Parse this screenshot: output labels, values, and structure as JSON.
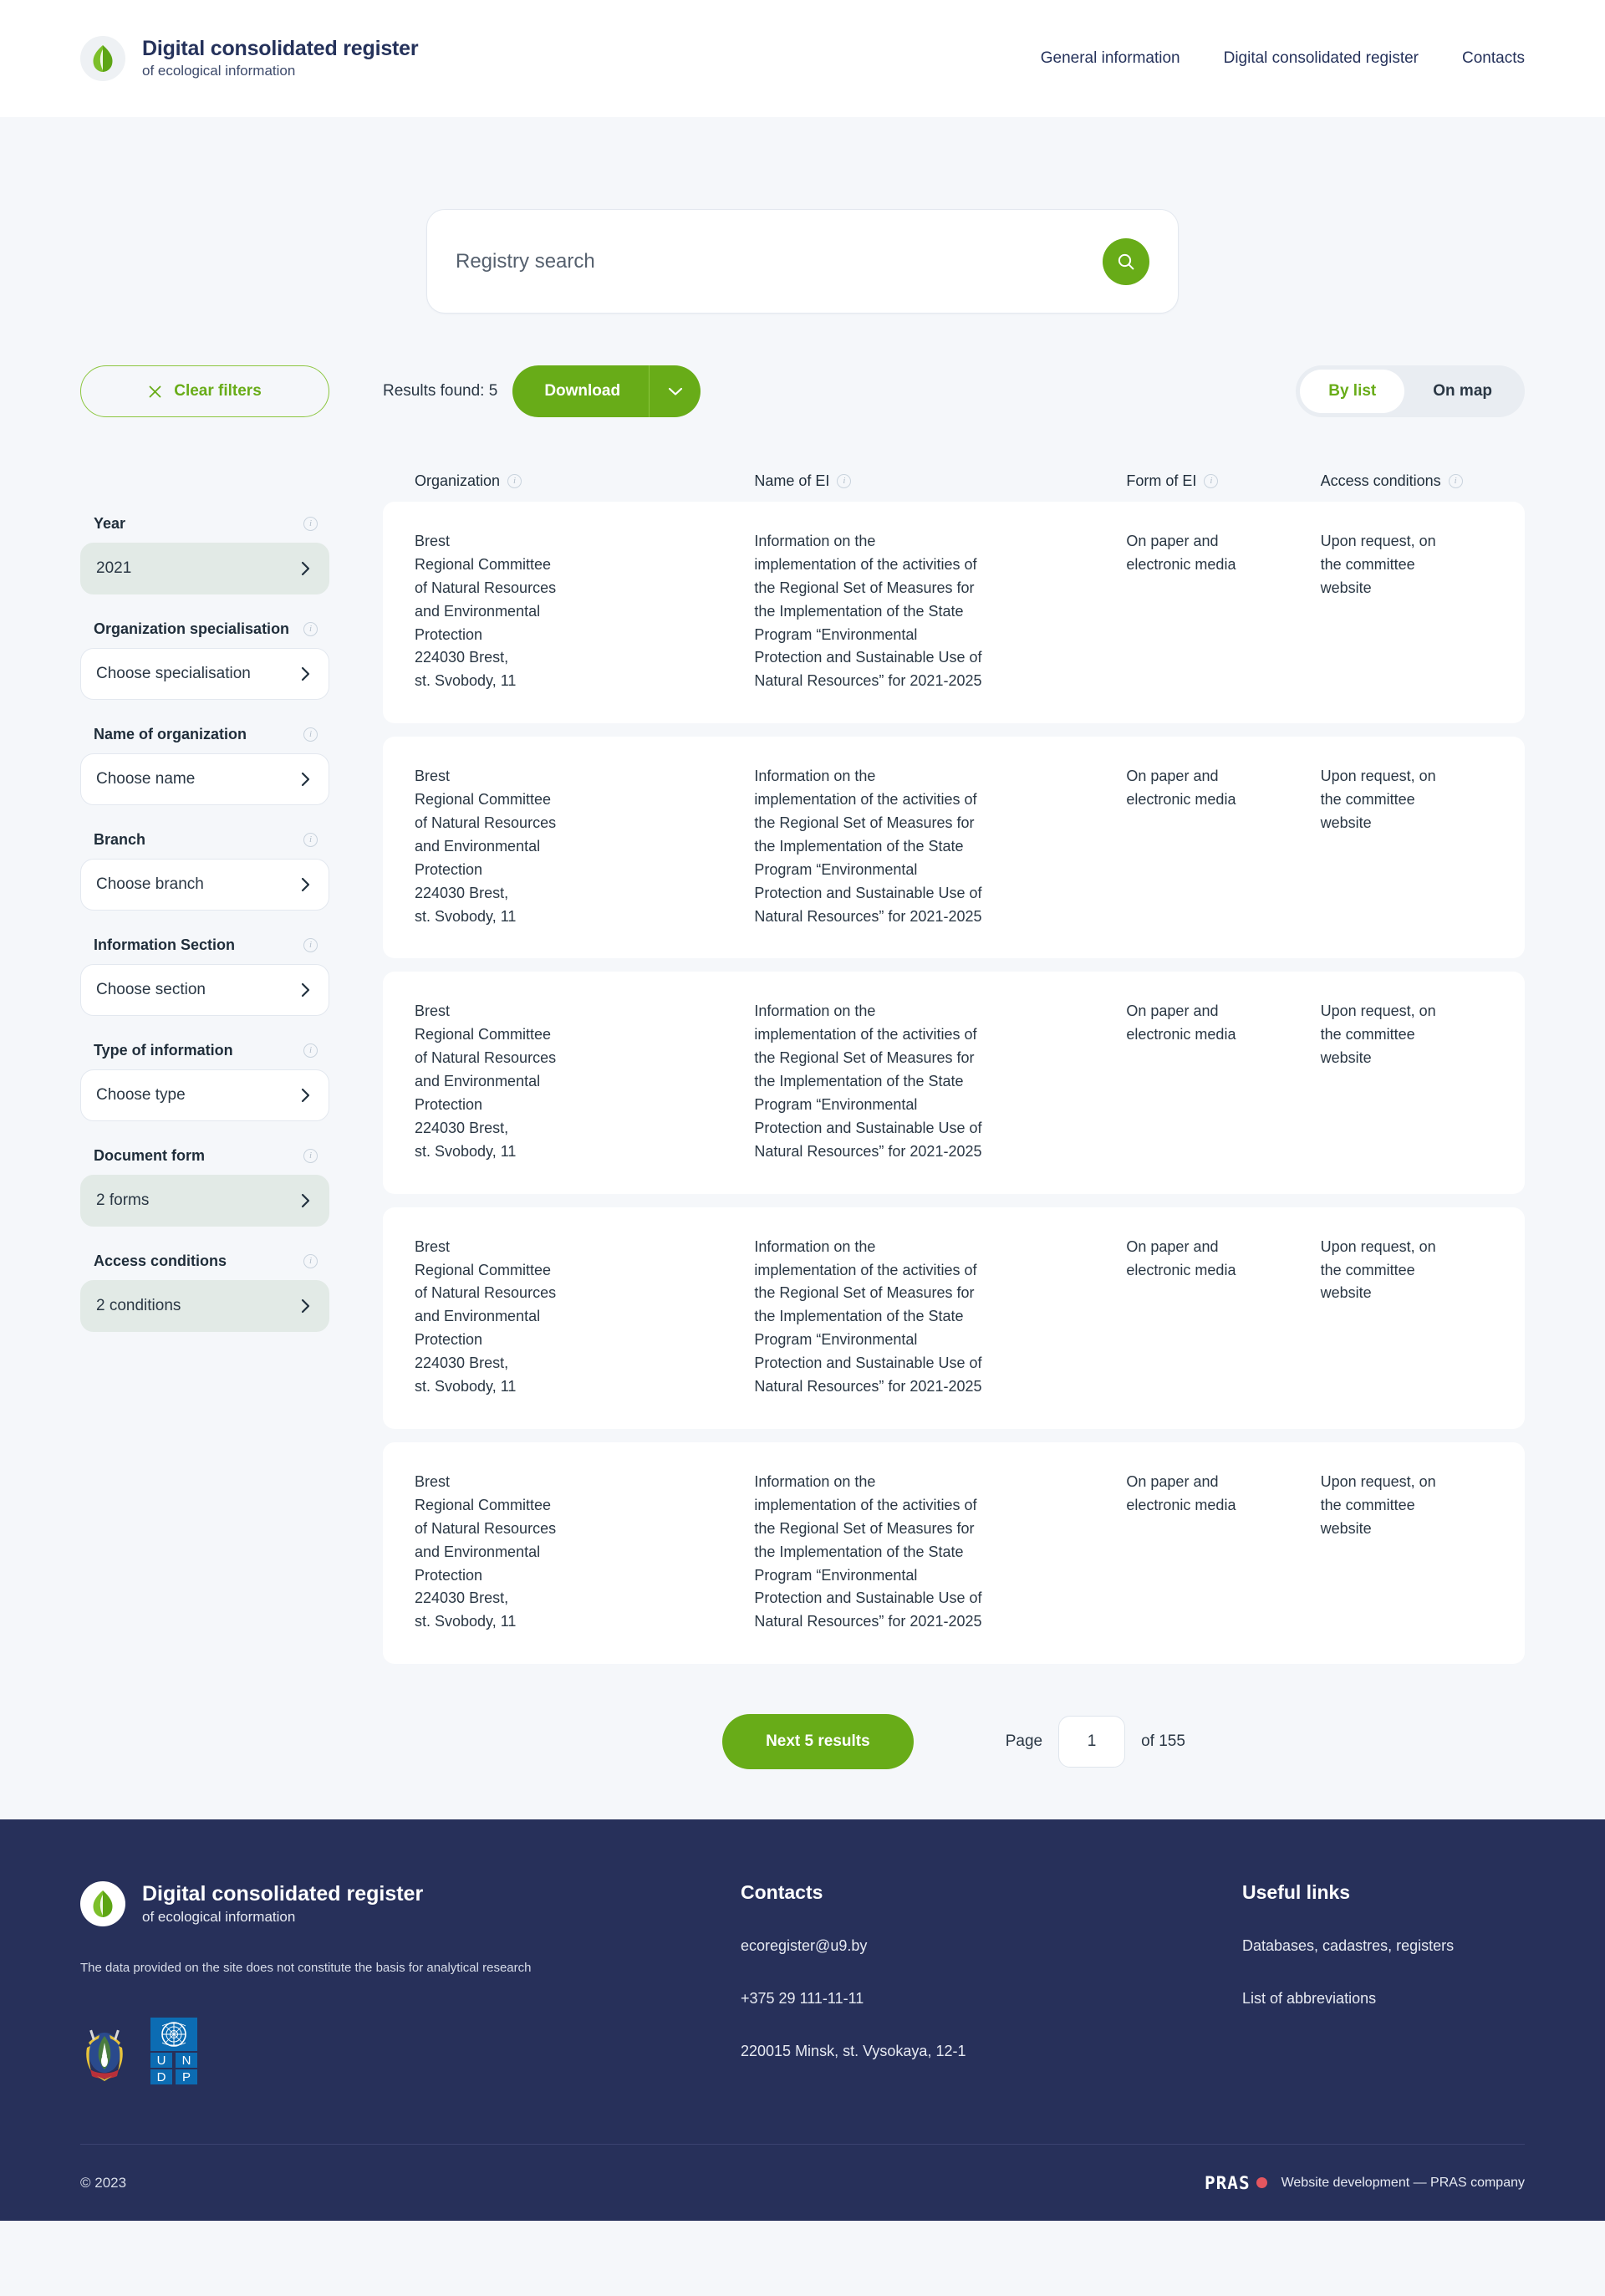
{
  "brand": {
    "title": "Digital consolidated register",
    "subtitle": "of ecological information"
  },
  "nav": {
    "items": [
      {
        "label": "General information"
      },
      {
        "label": "Digital consolidated register"
      },
      {
        "label": "Contacts"
      }
    ]
  },
  "search": {
    "placeholder": "Registry search",
    "value": "",
    "icon": "search-icon"
  },
  "sidebar": {
    "clear_filters_label": "Clear filters",
    "clear_icon": "close-x-icon",
    "filters": [
      {
        "label": "Year",
        "value": "2021",
        "selected": true
      },
      {
        "label": "Organization specialisation",
        "value": "Choose specialisation",
        "selected": false
      },
      {
        "label": "Name of organization",
        "value": "Choose name",
        "selected": false
      },
      {
        "label": "Branch",
        "value": "Choose branch",
        "selected": false
      },
      {
        "label": "Information Section",
        "value": "Choose section",
        "selected": false
      },
      {
        "label": "Type of information",
        "value": "Choose type",
        "selected": false
      },
      {
        "label": "Document form",
        "value": "2 forms",
        "selected": true
      },
      {
        "label": "Access conditions",
        "value": "2 conditions",
        "selected": true
      }
    ]
  },
  "toolbar": {
    "results_found": "Results found: 5",
    "download_label": "Download",
    "download_caret_icon": "chevron-down-icon",
    "view_by_list": "By list",
    "view_on_map": "On map",
    "active_view": "By list"
  },
  "table": {
    "columns": [
      {
        "label": "Organization"
      },
      {
        "label": "Name of EI"
      },
      {
        "label": "Form of EI"
      },
      {
        "label": "Access conditions"
      }
    ],
    "rows": [
      {
        "organization": "Brest\nRegional Committee\nof Natural Resources\nand Environmental\nProtection\n224030 Brest,\nst. Svobody, 11",
        "name_of_ei": "Information on the\nimplementation of the activities of\nthe Regional Set of Measures for\nthe Implementation of the State\nProgram “Environmental\nProtection and Sustainable Use of\nNatural Resources” for 2021-2025",
        "form_of_ei": "On paper and\nelectronic media",
        "access_conditions": "Upon request, on\nthe committee\nwebsite"
      },
      {
        "organization": "Brest\nRegional Committee\nof Natural Resources\nand Environmental\nProtection\n224030 Brest,\nst. Svobody, 11",
        "name_of_ei": "Information on the\nimplementation of the activities of\nthe Regional Set of Measures for\nthe Implementation of the State\nProgram “Environmental\nProtection and Sustainable Use of\nNatural Resources” for 2021-2025",
        "form_of_ei": "On paper and\nelectronic media",
        "access_conditions": "Upon request, on\nthe committee\nwebsite"
      },
      {
        "organization": "Brest\nRegional Committee\nof Natural Resources\nand Environmental\nProtection\n224030 Brest,\nst. Svobody, 11",
        "name_of_ei": "Information on the\nimplementation of the activities of\nthe Regional Set of Measures for\nthe Implementation of the State\nProgram “Environmental\nProtection and Sustainable Use of\nNatural Resources” for 2021-2025",
        "form_of_ei": "On paper and\nelectronic media",
        "access_conditions": "Upon request, on\nthe committee\nwebsite"
      },
      {
        "organization": "Brest\nRegional Committee\nof Natural Resources\nand Environmental\nProtection\n224030 Brest,\nst. Svobody, 11",
        "name_of_ei": "Information on the\nimplementation of the activities of\nthe Regional Set of Measures for\nthe Implementation of the State\nProgram “Environmental\nProtection and Sustainable Use of\nNatural Resources” for 2021-2025",
        "form_of_ei": "On paper and\nelectronic media",
        "access_conditions": "Upon request, on\nthe committee\nwebsite"
      },
      {
        "organization": "Brest\nRegional Committee\nof Natural Resources\nand Environmental\nProtection\n224030 Brest,\nst. Svobody, 11",
        "name_of_ei": "Information on the\nimplementation of the activities of\nthe Regional Set of Measures for\nthe Implementation of the State\nProgram “Environmental\nProtection and Sustainable Use of\nNatural Resources” for 2021-2025",
        "form_of_ei": "On paper and\nelectronic media",
        "access_conditions": "Upon request, on\nthe committee\nwebsite"
      }
    ]
  },
  "pagination": {
    "next_label": "Next 5 results",
    "page_label": "Page",
    "page_value": "1",
    "total_label": "of 155"
  },
  "footer": {
    "brand_title": "Digital consolidated register",
    "brand_subtitle": "of ecological information",
    "disclaimer": "The data provided on the site does not constitute the basis for analytical research",
    "badges": [
      {
        "name": "coat-of-arms-belarus"
      },
      {
        "name": "undp-logo",
        "letters": [
          "U",
          "N",
          "D",
          "P"
        ]
      }
    ],
    "contacts": {
      "title": "Contacts",
      "email": "ecoregister@u9.by",
      "phone": "+375 29 111-11-11",
      "address": "220015 Minsk, st. Vysokaya, 12-1"
    },
    "useful_links": {
      "title": "Useful links",
      "items": [
        {
          "label": "Databases, cadastres, registers"
        },
        {
          "label": "List of abbreviations"
        }
      ]
    },
    "copyright": "© 2023",
    "developer": {
      "logo_text": "PRAS",
      "credit": "Website development — PRAS company"
    }
  },
  "colors": {
    "green": "#68ac18",
    "green_light": "#8cc63f",
    "navy": "#27305a",
    "page_bg": "#f5f7fa",
    "selected_filter": "#e2eae6",
    "pras_dot": "#e4565f"
  }
}
